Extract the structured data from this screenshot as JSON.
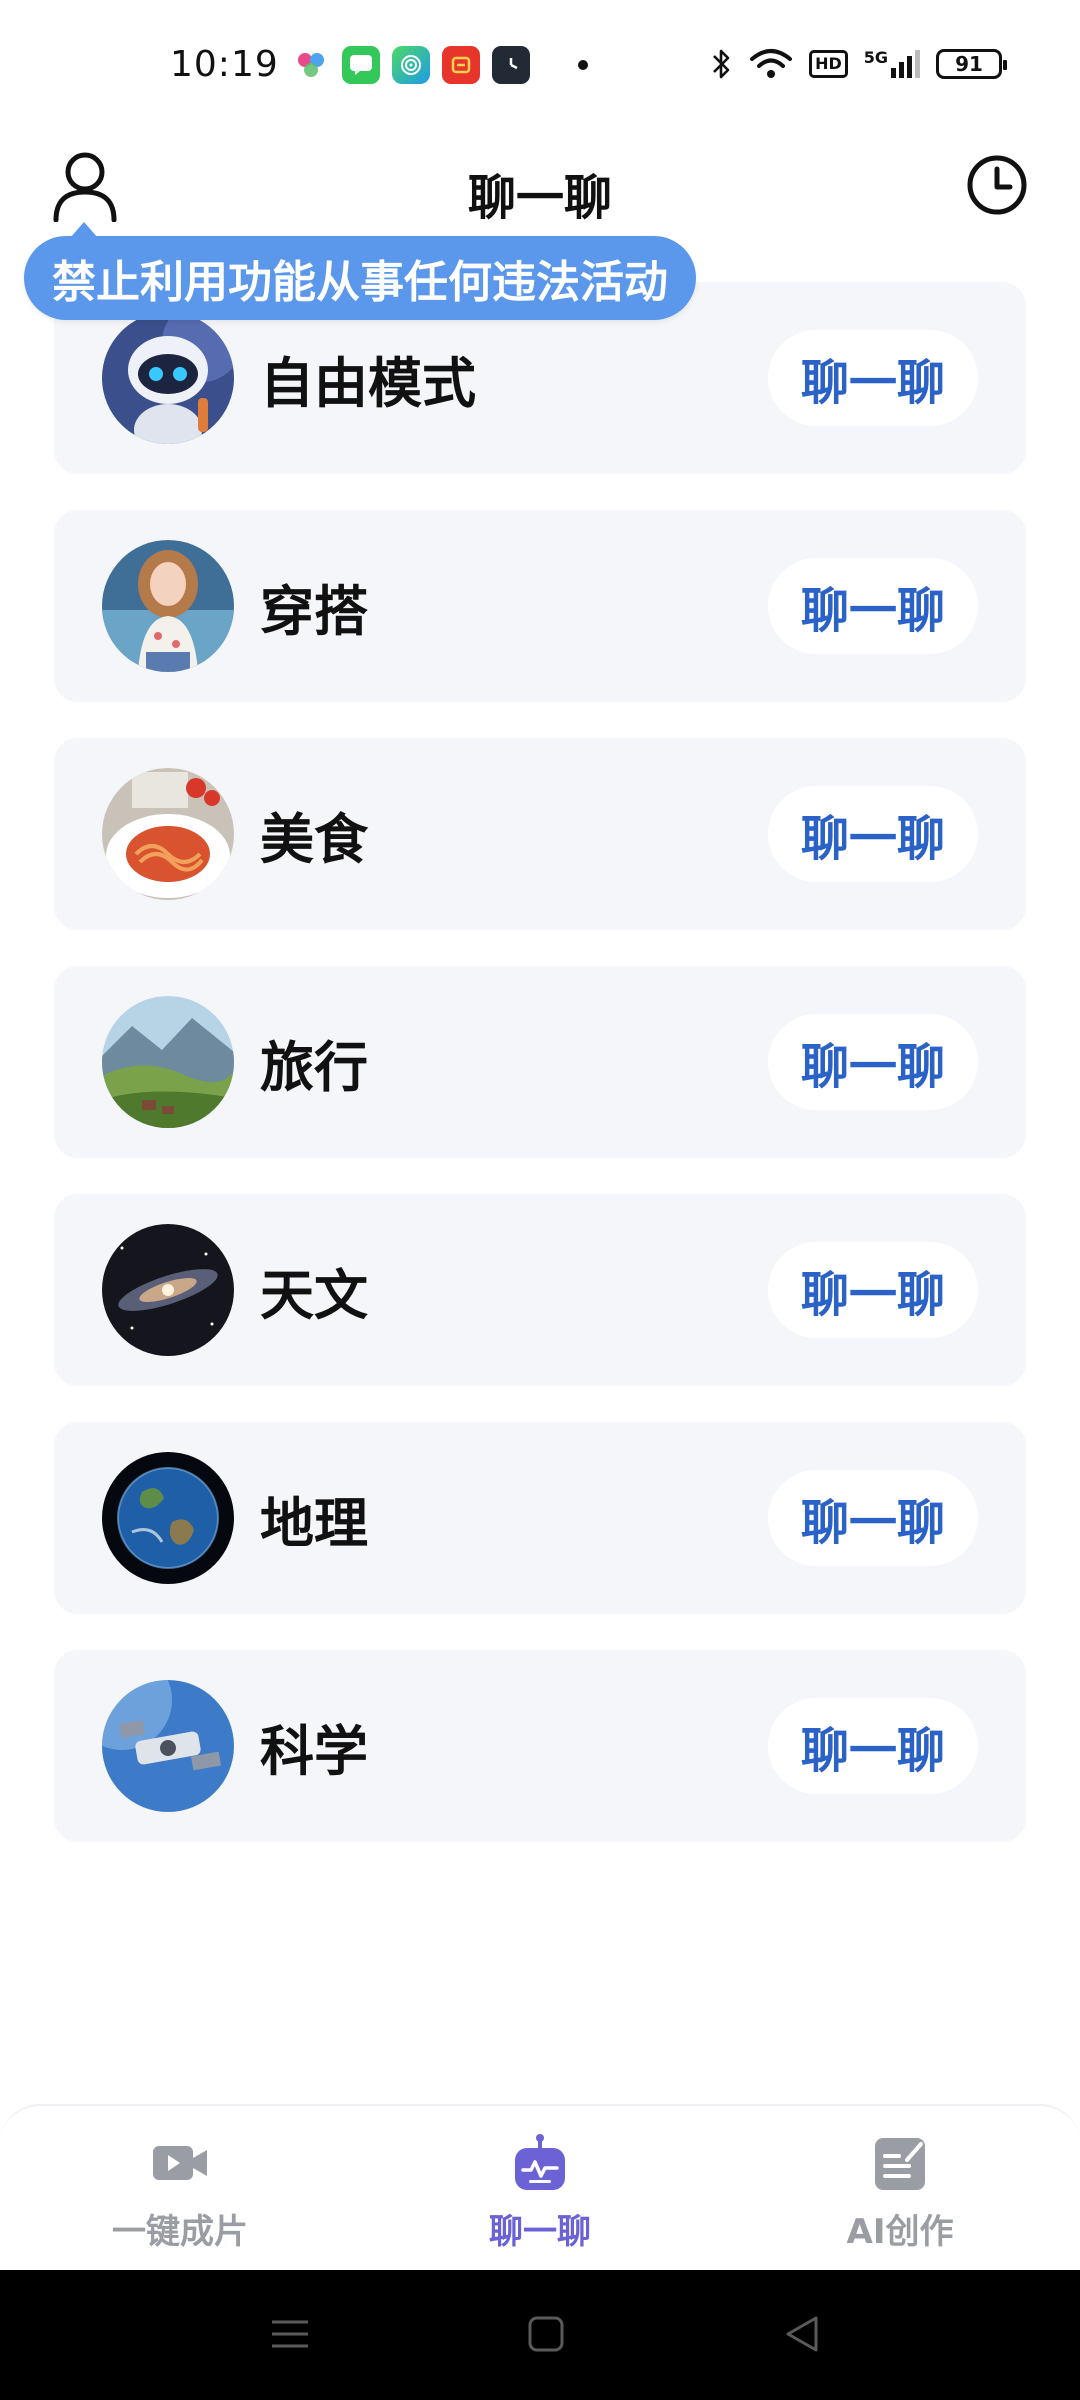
{
  "status_bar": {
    "time": "10:19",
    "battery": "91",
    "hd_label": "HD",
    "network_label": "5G",
    "notification_icons": [
      "app-logo-icon",
      "message-icon",
      "fingerprint-icon",
      "red-app-icon",
      "clock-app-icon"
    ],
    "system_icons": [
      "bluetooth-icon",
      "wifi-icon",
      "hd-icon",
      "signal-icon",
      "battery-icon"
    ]
  },
  "header": {
    "title": "聊一聊",
    "left_icon": "user-icon",
    "right_icon": "history-icon"
  },
  "warning": {
    "text": "禁止利用功能从事任何违法活动"
  },
  "categories": [
    {
      "label": "自由模式",
      "button": "聊一聊",
      "avatar": "robot"
    },
    {
      "label": "穿搭",
      "button": "聊一聊",
      "avatar": "fashion-girl"
    },
    {
      "label": "美食",
      "button": "聊一聊",
      "avatar": "pasta"
    },
    {
      "label": "旅行",
      "button": "聊一聊",
      "avatar": "landscape"
    },
    {
      "label": "天文",
      "button": "聊一聊",
      "avatar": "galaxy"
    },
    {
      "label": "地理",
      "button": "聊一聊",
      "avatar": "earth"
    },
    {
      "label": "科学",
      "button": "聊一聊",
      "avatar": "spacecraft"
    }
  ],
  "tabs": [
    {
      "label": "一键成片",
      "icon": "video-icon",
      "active": false
    },
    {
      "label": "聊一聊",
      "icon": "robot-icon",
      "active": true
    },
    {
      "label": "AI创作",
      "icon": "edit-note-icon",
      "active": false
    }
  ],
  "colors": {
    "accent": "#6b62d6",
    "button_text": "#2b62c7",
    "warning_bg": "#5b98ec",
    "card_bg": "#f4f6f9"
  }
}
